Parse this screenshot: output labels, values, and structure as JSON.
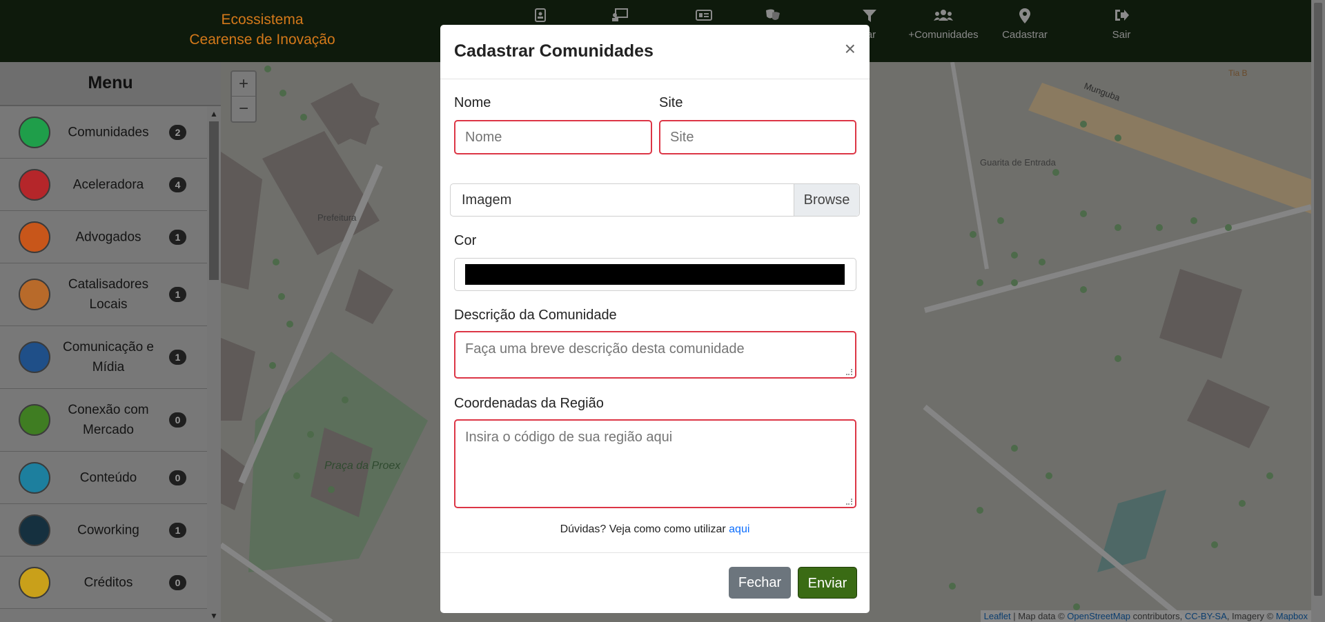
{
  "navbar": {
    "brand_line1": "Ecossistema",
    "brand_line2": "Cearense de Inovação",
    "items": [
      {
        "label": "",
        "icon": "id-badge-icon"
      },
      {
        "label": "",
        "icon": "presentation-icon"
      },
      {
        "label": "",
        "icon": "newspaper-icon"
      },
      {
        "label": "",
        "icon": "theater-masks-icon"
      },
      {
        "label": "rar",
        "icon": "filter-icon"
      },
      {
        "label": "+Comunidades",
        "icon": "users-icon"
      },
      {
        "label": "Cadastrar",
        "icon": "map-marker-icon"
      },
      {
        "label": "Sair",
        "icon": "sign-out-icon"
      }
    ]
  },
  "sidebar": {
    "title": "Menu",
    "items": [
      {
        "label": "Comunidades",
        "count": "2",
        "color": "#1f9e4a"
      },
      {
        "label": "Aceleradora",
        "count": "4",
        "color": "#b5262a"
      },
      {
        "label": "Advogados",
        "count": "1",
        "color": "#c8561a"
      },
      {
        "label": "Catalisadores Locais",
        "count": "1",
        "color": "#b86a2a"
      },
      {
        "label": "Comunicação e Mídia",
        "count": "1",
        "color": "#1f4f88"
      },
      {
        "label": "Conexão com Mercado",
        "count": "0",
        "color": "#3f7d22"
      },
      {
        "label": "Conteúdo",
        "count": "0",
        "color": "#1d7f9e"
      },
      {
        "label": "Coworking",
        "count": "1",
        "color": "#15303f"
      },
      {
        "label": "Créditos",
        "count": "0",
        "color": "#c9a01a"
      }
    ]
  },
  "map": {
    "labels": [
      "Prefeitura",
      "Praça da Proex",
      "Guarita de Entrada",
      "Tia B",
      "Munguba"
    ],
    "zoom_in": "+",
    "zoom_out": "−",
    "attribution": {
      "leaflet": "Leaflet",
      "sep": " | Map data © ",
      "osm": "OpenStreetMap",
      "contrib": " contributors, ",
      "ccbysa": "CC-BY-SA",
      "imagery": ", Imagery © ",
      "mapbox": "Mapbox"
    }
  },
  "modal": {
    "title": "Cadastrar Comunidades",
    "close_glyph": "×",
    "nome_label": "Nome",
    "nome_placeholder": "Nome",
    "site_label": "Site",
    "site_placeholder": "Site",
    "imagem_placeholder": "Imagem",
    "browse_label": "Browse",
    "cor_label": "Cor",
    "cor_value": "#000000",
    "descricao_label": "Descrição da Comunidade",
    "descricao_placeholder": "Faça uma breve descrição desta comunidade",
    "coordenadas_label": "Coordenadas da Região",
    "coordenadas_placeholder": "Insira o código de sua região aqui",
    "help_text": "Dúvidas? Veja como como utilizar ",
    "help_link": "aqui",
    "btn_fechar": "Fechar",
    "btn_enviar": "Enviar"
  }
}
